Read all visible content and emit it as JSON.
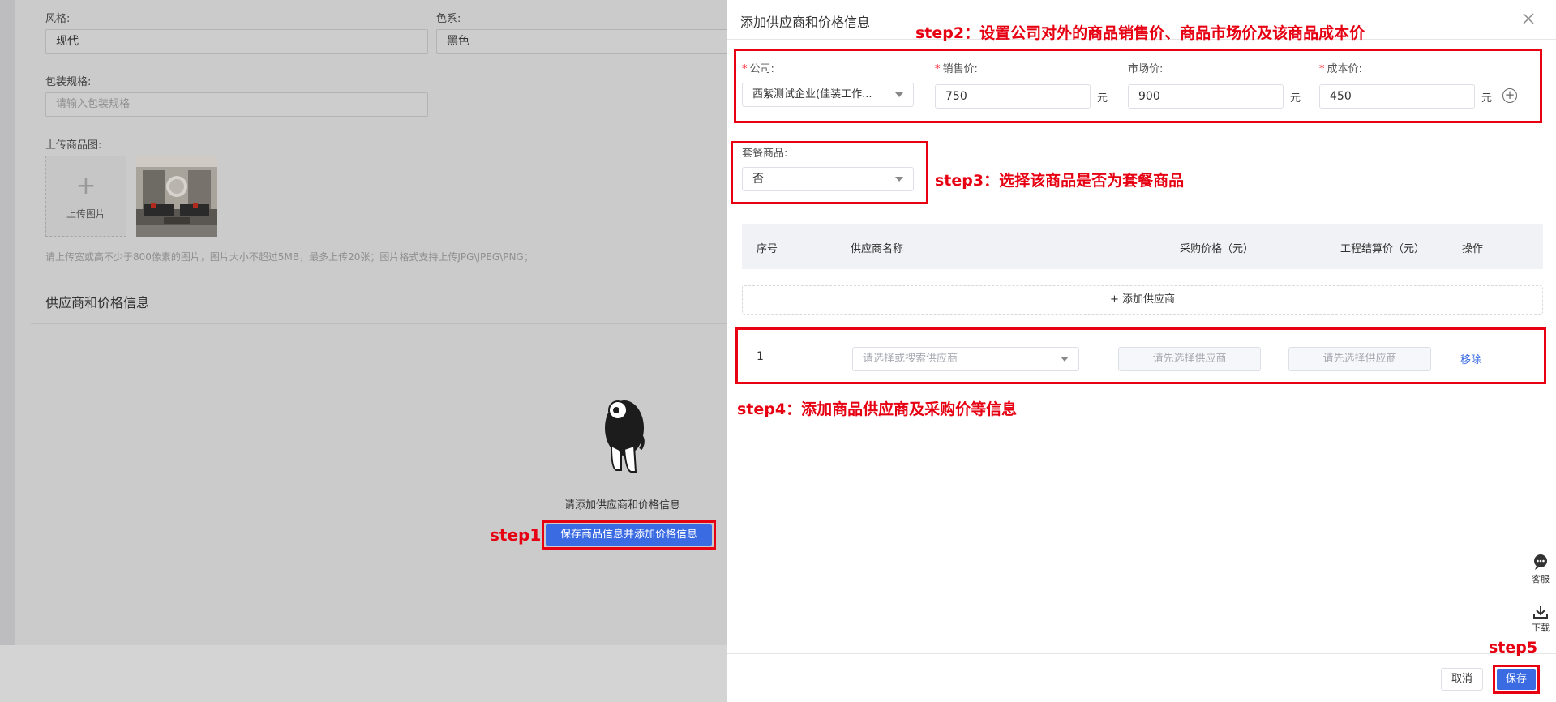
{
  "background": {
    "style_label": "风格:",
    "style_value": "现代",
    "color_label": "色系:",
    "color_value": "黑色",
    "package_label": "包装规格:",
    "package_placeholder": "请输入包装规格",
    "upload_label": "上传商品图:",
    "upload_button": "上传图片",
    "upload_hint": "请上传宽或高不少于800像素的图片，图片大小不超过5MB，最多上传20张；图片格式支持上传JPG\\JPEG\\PNG；",
    "section_title": "供应商和价格信息",
    "empty_text": "请添加供应商和价格信息",
    "save_and_add_button": "保存商品信息并添加价格信息"
  },
  "drawer": {
    "title": "添加供应商和价格信息",
    "company_label": "公司:",
    "company_value": "西紫测试企业(佳装工作...",
    "sale_price_label": "销售价:",
    "sale_price_value": "750",
    "market_price_label": "市场价:",
    "market_price_value": "900",
    "cost_price_label": "成本价:",
    "cost_price_value": "450",
    "unit": "元",
    "package_goods_label": "套餐商品:",
    "package_goods_value": "否",
    "table_headers": [
      "序号",
      "供应商名称",
      "采购价格（元）",
      "工程结算价（元）",
      "操作"
    ],
    "add_supplier_button": "+ 添加供应商",
    "row": {
      "index": "1",
      "supplier_placeholder": "请选择或搜索供应商",
      "purchase_price_placeholder": "请先选择供应商",
      "settlement_price_placeholder": "请先选择供应商",
      "remove_link": "移除"
    },
    "cancel_button": "取消",
    "save_button": "保存",
    "side_tools": {
      "service_label": "客服",
      "download_label": "下载"
    }
  },
  "annotations": {
    "step1": "step1",
    "step2": "step2：设置公司对外的商品销售价、商品市场价及该商品成本价",
    "step3": "step3：选择该商品是否为套餐商品",
    "step4": "step4：添加商品供应商及采购价等信息",
    "step5": "step5"
  },
  "colors": {
    "primary": "#3a6be3",
    "annotation_red": "#e60012",
    "required_star": "#f5222d"
  }
}
